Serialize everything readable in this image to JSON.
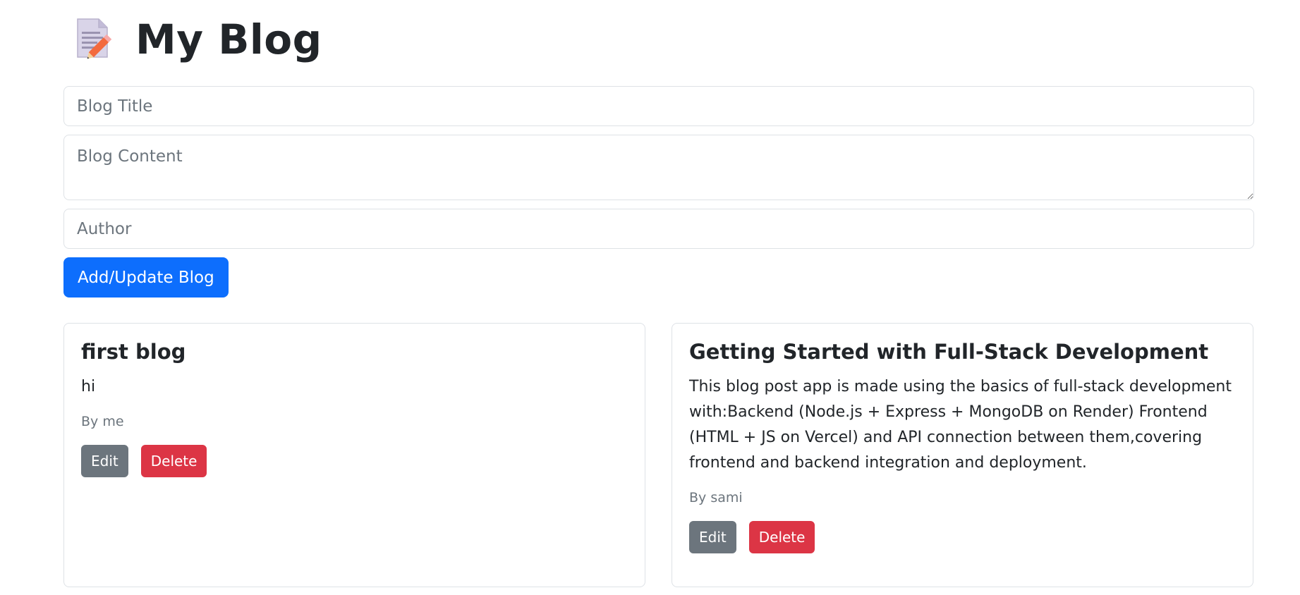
{
  "header": {
    "icon": "memo-icon",
    "title": "My Blog"
  },
  "form": {
    "title_placeholder": "Blog Title",
    "title_value": "",
    "content_placeholder": "Blog Content",
    "content_value": "",
    "author_placeholder": "Author",
    "author_value": "",
    "submit_label": "Add/Update Blog"
  },
  "blogs": [
    {
      "title": "first blog",
      "content": "hi",
      "author": "By me",
      "edit_label": "Edit",
      "delete_label": "Delete"
    },
    {
      "title": "Getting Started with Full-Stack Development",
      "content": "This blog post app is made using the basics of full-stack development with:Backend (Node.js + Express + MongoDB on Render) Frontend (HTML + JS on Vercel) and API connection between them,covering frontend and backend integration and deployment.",
      "author": "By sami",
      "edit_label": "Edit",
      "delete_label": "Delete"
    }
  ],
  "colors": {
    "primary": "#0d6efd",
    "secondary": "#6c757d",
    "danger": "#dc3545",
    "border": "#dee2e6"
  }
}
